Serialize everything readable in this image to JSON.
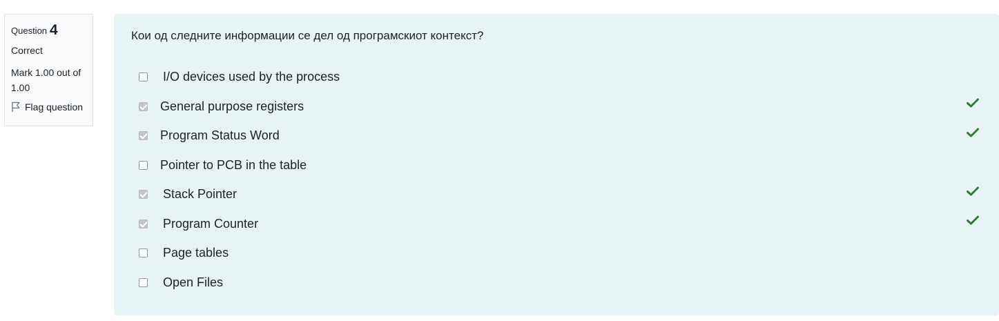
{
  "info": {
    "question_label": "Question",
    "question_number": "4",
    "state": "Correct",
    "grade": "Mark 1.00 out of 1.00",
    "flag_label": "Flag question"
  },
  "question": {
    "text": "Кои од следните информации се дел од програмскиот контекст?",
    "answers": [
      {
        "label": "I/O devices used by the process",
        "checked": false,
        "correct_mark": false
      },
      {
        "label": "General purpose registers",
        "checked": true,
        "correct_mark": true
      },
      {
        "label": "Program Status Word",
        "checked": true,
        "correct_mark": true
      },
      {
        "label": "Pointer to PCB in the table",
        "checked": false,
        "correct_mark": false
      },
      {
        "label": "Stack Pointer",
        "checked": true,
        "correct_mark": true
      },
      {
        "label": "Program Counter",
        "checked": true,
        "correct_mark": true
      },
      {
        "label": "Page tables",
        "checked": false,
        "correct_mark": false
      },
      {
        "label": "Open Files",
        "checked": false,
        "correct_mark": false
      }
    ]
  },
  "colors": {
    "correct_tick": "#2e7d32",
    "content_background": "#e7f3f5",
    "info_background": "#f8f9fa"
  },
  "icons": {
    "flag": "flag-icon",
    "correct": "check-icon"
  }
}
